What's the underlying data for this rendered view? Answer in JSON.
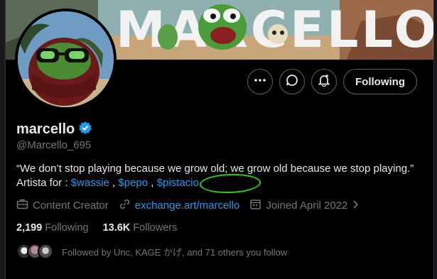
{
  "banner": {
    "title_text": "MARCELLO"
  },
  "profile": {
    "display_name": "marcello",
    "handle": "@Marcello_695",
    "bio_text": "“We don’t stop playing because we grow old; we grow old because we stop playing.” Artista for : ",
    "bio_links": [
      "$wassie",
      "$pepo",
      "$pistacio"
    ],
    "bio_sep_1": " , ",
    "bio_sep_2": " , ",
    "category": "Content Creator",
    "website": "exchange.art/marcello",
    "joined": "Joined April 2022",
    "following_count": "2,199",
    "following_label": "Following",
    "followers_count": "13.6K",
    "followers_label": "Followers",
    "followed_by": "Followed by Unc, KAGE かげ, and 71 others you follow"
  },
  "actions": {
    "more_label": "more",
    "follow_button_label": "Following"
  },
  "colors": {
    "link": "#1d9bf0",
    "verified": "#1d9bf0",
    "highlight_circle": "#2ecc1a",
    "muted_text": "#71767b"
  },
  "icons": [
    "more-icon",
    "message-icon",
    "notification-bell-icon",
    "verified-badge-icon",
    "briefcase-icon",
    "link-icon",
    "calendar-icon",
    "chevron-right-icon"
  ]
}
